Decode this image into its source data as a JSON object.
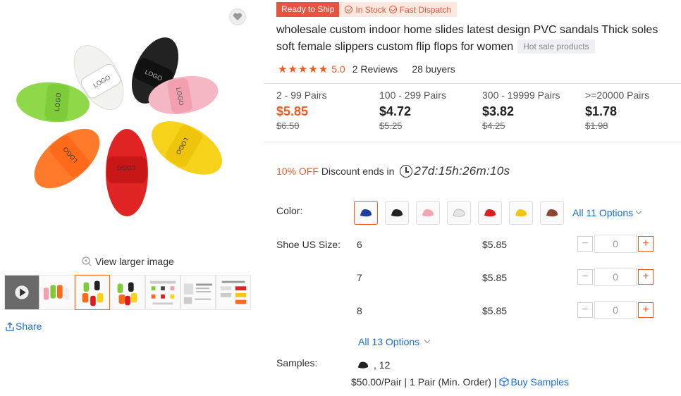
{
  "gallery": {
    "view_larger": "View larger image",
    "share": "Share"
  },
  "badges": {
    "ready": "Ready to Ship",
    "in_stock": "In Stock",
    "fast_dispatch": "Fast Dispatch"
  },
  "product": {
    "title": "wholesale custom indoor home slides latest design PVC sandals Thick soles soft female slippers custom flip flops for women",
    "hot_tag": "Hot sale products",
    "stars": "★★★★★",
    "score": "5.0",
    "reviews": "2 Reviews",
    "buyers": "28 buyers"
  },
  "tiers": [
    {
      "range": "2 - 99 Pairs",
      "price": "$5.85",
      "old": "$6.50"
    },
    {
      "range": "100 - 299 Pairs",
      "price": "$4.72",
      "old": "$5.25"
    },
    {
      "range": "300 - 19999 Pairs",
      "price": "$3.82",
      "old": "$4.25"
    },
    {
      "range": ">=20000 Pairs",
      "price": "$1.78",
      "old": "$1.98"
    }
  ],
  "discount": {
    "off": "10% OFF",
    "text": "Discount ends in",
    "countdown": "27d:15h:26m:10s"
  },
  "options": {
    "color_label": "Color:",
    "colors": [
      "#1f3d9e",
      "#222222",
      "#f4a6b4",
      "#e6e6e6",
      "#d81e1e",
      "#f3c614",
      "#8a4a32"
    ],
    "all_colors": "All 11 Options",
    "size_label": "Shoe US Size:",
    "sizes": [
      {
        "size": "6",
        "price": "$5.85",
        "qty": "0"
      },
      {
        "size": "7",
        "price": "$5.85",
        "qty": "0"
      },
      {
        "size": "8",
        "price": "$5.85",
        "qty": "0"
      }
    ],
    "all_sizes": "All 13 Options"
  },
  "samples": {
    "label": "Samples:",
    "count": ", 12",
    "price": "$50.00/Pair | 1 Pair (Min. Order) |",
    "buy": "Buy Samples"
  },
  "slipper_colors": [
    "#f5f5f2",
    "#1a1a1a",
    "#f29fb0",
    "#7fcc3a",
    "#f7d21a",
    "#ff6a1a",
    "#dd1d1d"
  ],
  "slipper_logo": "LOGO"
}
